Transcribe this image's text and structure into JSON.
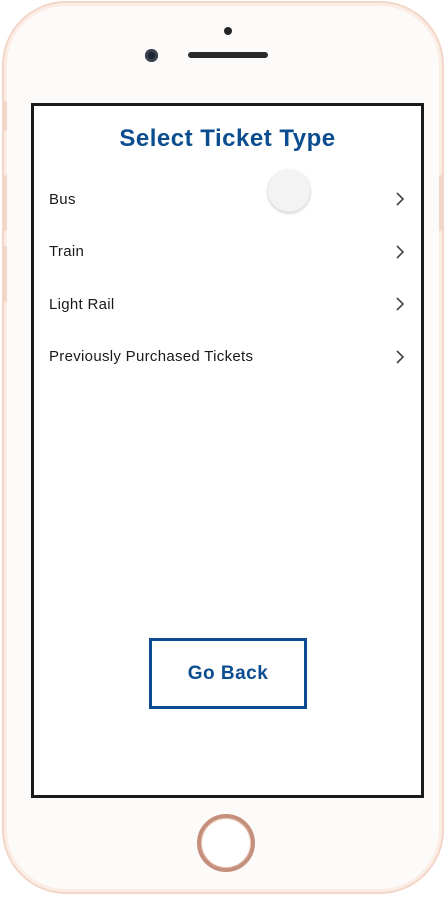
{
  "screen": {
    "title": "Select Ticket Type",
    "options": [
      {
        "label": "Bus",
        "icon": "chevron-right-icon"
      },
      {
        "label": "Train",
        "icon": "chevron-right-icon"
      },
      {
        "label": "Light Rail",
        "icon": "chevron-right-icon"
      },
      {
        "label": "Previously Purchased Tickets",
        "icon": "chevron-right-icon"
      }
    ],
    "go_back_label": "Go Back"
  },
  "colors": {
    "accent": "#0b4d8e",
    "frame": "#f2d6c8",
    "text": "#1a1a1a"
  }
}
